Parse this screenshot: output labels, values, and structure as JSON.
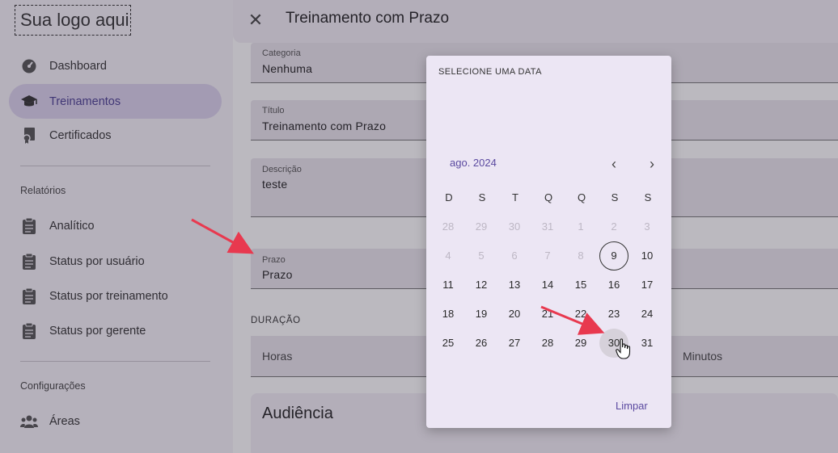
{
  "app": {
    "logo_text": "Sua logo aqui"
  },
  "sidebar": {
    "items": [
      {
        "label": "Dashboard",
        "icon": "dashboard-icon"
      },
      {
        "label": "Treinamentos",
        "icon": "graduation-cap-icon",
        "active": true
      },
      {
        "label": "Certificados",
        "icon": "certificate-icon"
      }
    ],
    "sections": [
      {
        "title": "Relatórios",
        "items": [
          {
            "label": "Analítico",
            "icon": "clipboard-icon"
          },
          {
            "label": "Status por usuário",
            "icon": "clipboard-icon"
          },
          {
            "label": "Status por treinamento",
            "icon": "clipboard-icon"
          },
          {
            "label": "Status por gerente",
            "icon": "clipboard-icon"
          }
        ]
      },
      {
        "title": "Configurações",
        "items": [
          {
            "label": "Áreas",
            "icon": "users-group-icon"
          }
        ]
      }
    ]
  },
  "header": {
    "title": "Treinamento com Prazo"
  },
  "form": {
    "categoria": {
      "label": "Categoria",
      "value": "Nenhuma"
    },
    "titulo": {
      "label": "Título",
      "value": "Treinamento com Prazo"
    },
    "descricao": {
      "label": "Descrição",
      "value": "teste"
    },
    "prazo": {
      "label": "Prazo",
      "value": "Prazo"
    },
    "duracao": {
      "label": "DURAÇÃO",
      "horas": "Horas",
      "minutos": "Minutos"
    },
    "audiencia": {
      "title": "Audiência"
    }
  },
  "datepicker": {
    "header": "SELECIONE UMA DATA",
    "month": "ago. 2024",
    "prev": "‹",
    "next": "›",
    "weekdays": [
      "D",
      "S",
      "T",
      "Q",
      "Q",
      "S",
      "S"
    ],
    "weeks": [
      [
        "28",
        "29",
        "30",
        "31",
        "1",
        "2",
        "3"
      ],
      [
        "4",
        "5",
        "6",
        "7",
        "8",
        "9",
        "10"
      ],
      [
        "11",
        "12",
        "13",
        "14",
        "15",
        "16",
        "17"
      ],
      [
        "18",
        "19",
        "20",
        "21",
        "22",
        "23",
        "24"
      ],
      [
        "25",
        "26",
        "27",
        "28",
        "29",
        "30",
        "31"
      ]
    ],
    "disabled": [
      "0-0",
      "0-1",
      "0-2",
      "0-3",
      "0-4",
      "0-5",
      "0-6",
      "1-0",
      "1-1",
      "1-2",
      "1-3",
      "1-4"
    ],
    "today": "1-5",
    "hovered": "4-5",
    "clear_label": "Limpar"
  },
  "colors": {
    "accent": "#5b4aa0",
    "active_nav": "#dcd3ee",
    "annotation_arrow": "#e8394f"
  }
}
